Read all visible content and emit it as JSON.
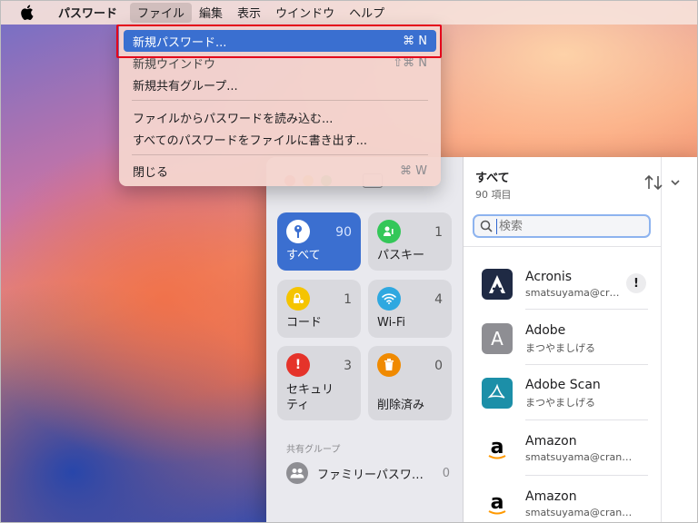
{
  "menubar": {
    "app_name": "パスワード",
    "items": [
      "ファイル",
      "編集",
      "表示",
      "ウインドウ",
      "ヘルプ"
    ]
  },
  "file_menu": {
    "items": [
      {
        "label": "新規パスワード...",
        "shortcut": "⌘ N"
      },
      {
        "label": "新規ウインドウ",
        "shortcut": "⇧⌘ N"
      },
      {
        "label": "新規共有グループ..."
      },
      {
        "label": "ファイルからパスワードを読み込む..."
      },
      {
        "label": "すべてのパスワードをファイルに書き出す..."
      },
      {
        "label": "閉じる",
        "shortcut": "⌘ W"
      }
    ]
  },
  "sidebar": {
    "tiles": [
      {
        "label": "すべて",
        "count": "90",
        "icon": "key-icon",
        "color": "#3b6fd0"
      },
      {
        "label": "パスキー",
        "count": "1",
        "icon": "person-key-icon",
        "color": "#34c759"
      },
      {
        "label": "コード",
        "count": "1",
        "icon": "lock-clock-icon",
        "color": "#f5c400"
      },
      {
        "label": "Wi-Fi",
        "count": "4",
        "icon": "wifi-icon",
        "color": "#2fa8e0"
      },
      {
        "label": "セキュリティ",
        "count": "3",
        "icon": "exclamation-icon",
        "color": "#e5332a"
      },
      {
        "label": "削除済み",
        "count": "0",
        "icon": "trash-icon",
        "color": "#f08a00"
      }
    ],
    "shared_section_label": "共有グループ",
    "shared_group": {
      "label": "ファミリーパスワ…",
      "count": "0"
    }
  },
  "list": {
    "title": "すべて",
    "subtitle": "90 項目",
    "search_placeholder": "検索",
    "entries": [
      {
        "name": "Acronis",
        "user": "smatsuyama@cr…",
        "logo": "acronis-logo-icon",
        "warning": "!"
      },
      {
        "name": "Adobe",
        "user": "まつやましげる",
        "logo": "letter-a-icon"
      },
      {
        "name": "Adobe Scan",
        "user": "まつやましげる",
        "logo": "adobe-scan-logo-icon"
      },
      {
        "name": "Amazon",
        "user": "smatsuyama@cran…",
        "logo": "amazon-logo-icon"
      },
      {
        "name": "Amazon",
        "user": "smatsuyama@cran…",
        "logo": "amazon-logo-icon"
      }
    ]
  },
  "colors": {
    "accent": "#3a6fd0",
    "highlight_box": "#e4001a"
  }
}
